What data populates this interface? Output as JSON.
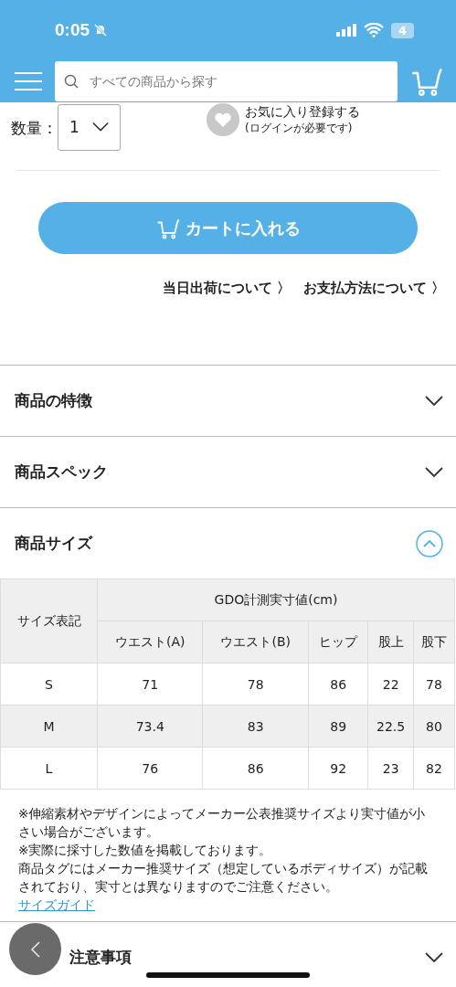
{
  "status_bar": {
    "time": "0:05",
    "battery": "4"
  },
  "header": {
    "search": {
      "placeholder": "すべての商品から探す"
    }
  },
  "quantity": {
    "label": "数量：",
    "value": "1"
  },
  "favorite": {
    "title": "お気に入り登録する",
    "note": "(ログインが必要です)"
  },
  "cart_button": "カートに入れる",
  "links": [
    {
      "label": "当日出荷について",
      "arrow": "〉"
    },
    {
      "label": "お支払方法について",
      "arrow": "〉"
    }
  ],
  "sections": [
    {
      "title": "商品の特徴",
      "expanded": false
    },
    {
      "title": "商品スペック",
      "expanded": false
    },
    {
      "title": "商品サイズ",
      "expanded": true,
      "table": {
        "corner": "サイズ表記",
        "group": "GDO計測実寸値(cm)",
        "columns": [
          "ウエスト(A)",
          "ウエスト(B)",
          "ヒップ",
          "股上",
          "股下"
        ],
        "rows": [
          {
            "size": "S",
            "values": [
              "71",
              "78",
              "86",
              "22",
              "78"
            ]
          },
          {
            "size": "M",
            "values": [
              "73.4",
              "83",
              "89",
              "22.5",
              "80"
            ]
          },
          {
            "size": "L",
            "values": [
              "76",
              "86",
              "92",
              "23",
              "82"
            ]
          }
        ]
      },
      "notes": [
        "※伸縮素材やデザインによってメーカー公表推奨サイズより実寸値が小さい場合がございます。",
        "※実際に採寸した数値を掲載しております。",
        "商品タグにはメーカー推奨サイズ（想定しているボディサイズ）が記載されており、実寸とは異なりますのでご注意ください。"
      ],
      "link": "サイズガイド"
    },
    {
      "title": "注意事項",
      "expanded": false
    }
  ]
}
